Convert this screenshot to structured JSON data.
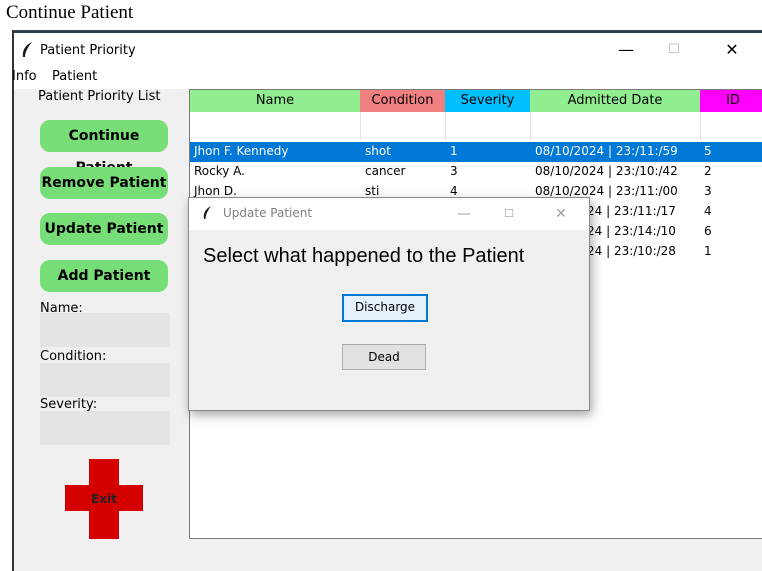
{
  "caption": "Continue Patient",
  "window": {
    "title": "Patient Priority",
    "controls": {
      "minimize": "—",
      "maximize": "☐",
      "close": "✕"
    }
  },
  "menubar": [
    "Info",
    "Patient"
  ],
  "sidebar": {
    "title": "Patient Priority List",
    "buttons": [
      "Continue Patient",
      "Remove Patient",
      "Update Patient",
      "Add Patient"
    ],
    "fields": [
      {
        "label": "Name:",
        "value": ""
      },
      {
        "label": "Condition:",
        "value": ""
      },
      {
        "label": "Severity:",
        "value": ""
      }
    ],
    "exit_label": "Exit"
  },
  "table": {
    "columns": [
      {
        "label": "Name",
        "color": "#90ee90"
      },
      {
        "label": "Condition",
        "color": "#f08080"
      },
      {
        "label": "Severity",
        "color": "#00bfff"
      },
      {
        "label": "Admitted Date",
        "color": "#90ee90"
      },
      {
        "label": "ID",
        "color": "#ff00ff"
      }
    ],
    "selected_row": 0,
    "rows": [
      {
        "name": "Jhon F. Kennedy",
        "condition": "shot",
        "severity": "1",
        "date": "08/10/2024 | 23:/11:/59",
        "id": "5"
      },
      {
        "name": "Rocky A.",
        "condition": "cancer",
        "severity": "3",
        "date": "08/10/2024 | 23:/10:/42",
        "id": "2"
      },
      {
        "name": "Jhon D.",
        "condition": "sti",
        "severity": "4",
        "date": "08/10/2024 | 23:/11:/00",
        "id": "3"
      },
      {
        "name": "",
        "condition": "",
        "severity": "",
        "date": "24 | 23:/11:/17",
        "id": "4"
      },
      {
        "name": "",
        "condition": "",
        "severity": "",
        "date": "24 | 23:/14:/10",
        "id": "6"
      },
      {
        "name": "",
        "condition": "",
        "severity": "",
        "date": "24 | 23:/10:/28",
        "id": "1"
      }
    ]
  },
  "dialog": {
    "title": "Update Patient",
    "controls": {
      "minimize": "—",
      "maximize": "☐",
      "close": "✕"
    },
    "prompt": "Select what happened to the Patient",
    "buttons": [
      "Discharge",
      "Dead"
    ]
  },
  "colors": {
    "selection": "#0078d7",
    "button_green": "#77dd77",
    "exit_red": "#d40000"
  },
  "icons": [
    "feather-icon",
    "exit-cross-icon"
  ]
}
